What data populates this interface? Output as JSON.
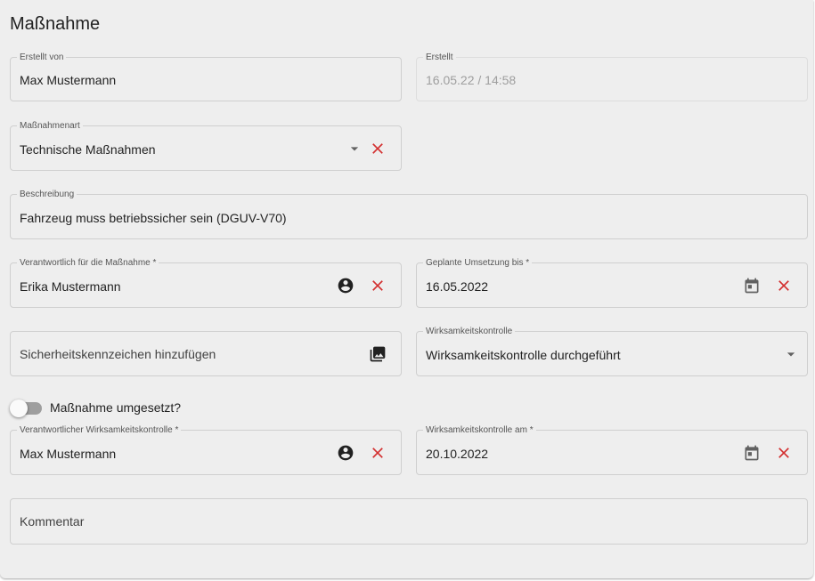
{
  "page": {
    "title": "Maßnahme"
  },
  "fields": {
    "created_by": {
      "label": "Erstellt von",
      "value": "Max Mustermann"
    },
    "created": {
      "label": "Erstellt",
      "value": "16.05.22 / 14:58"
    },
    "measure_type": {
      "label": "Maßnahmenart",
      "value": "Technische Maßnahmen"
    },
    "description": {
      "label": "Beschreibung",
      "value": "Fahrzeug muss betriebssicher sein (DGUV-V70)"
    },
    "responsible": {
      "label": "Verantwortlich für die Maßnahme *",
      "value": "Erika Mustermann"
    },
    "planned_date": {
      "label": "Geplante Umsetzung bis *",
      "value": "16.05.2022"
    },
    "safety_sign": {
      "placeholder": "Sicherheitskennzeichen hinzufügen"
    },
    "effectiveness_check": {
      "label": "Wirksamkeitskontrolle",
      "value": "Wirksamkeitskontrolle durchgeführt"
    },
    "implemented_toggle": {
      "label": "Maßnahme umgesetzt?",
      "checked": false
    },
    "effectiveness_responsible": {
      "label": "Verantwortlicher Wirksamkeitskontrolle *",
      "value": "Max Mustermann"
    },
    "effectiveness_date": {
      "label": "Wirksamkeitskontrolle am *",
      "value": "20.10.2022"
    },
    "comment": {
      "placeholder": "Kommentar"
    }
  },
  "icons": {
    "clear": "close-icon",
    "dropdown": "arrow-drop-down-icon",
    "person": "account-circle-icon",
    "calendar": "calendar-icon",
    "image": "photo-library-icon"
  },
  "colors": {
    "clear_icon": "#d32f2f",
    "icon_dark": "#212121",
    "icon_grey": "#616161"
  }
}
